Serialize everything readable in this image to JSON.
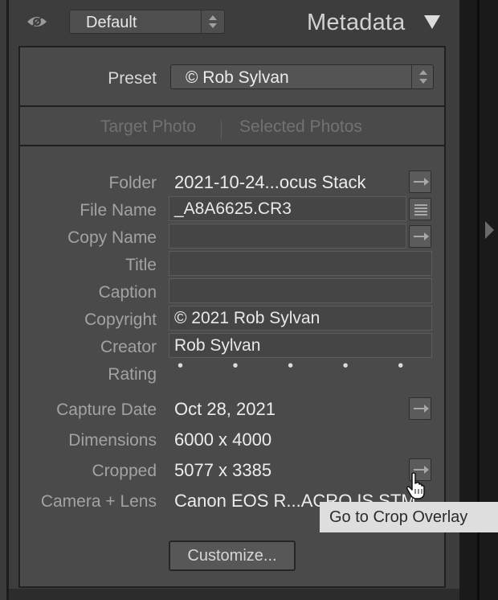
{
  "header": {
    "preset_value": "Default",
    "panel_title": "Metadata"
  },
  "preset_row": {
    "label": "Preset",
    "value": "© Rob Sylvan"
  },
  "target": {
    "tab_target_photo": "Target Photo",
    "tab_selected_photos": "Selected Photos"
  },
  "fields": {
    "folder": {
      "label": "Folder",
      "value": "2021-10-24...ocus Stack"
    },
    "file_name": {
      "label": "File Name",
      "value": "_A8A6625.CR3"
    },
    "copy_name": {
      "label": "Copy Name",
      "value": ""
    },
    "title": {
      "label": "Title",
      "value": ""
    },
    "caption": {
      "label": "Caption",
      "value": ""
    },
    "copyright": {
      "label": "Copyright",
      "value": "© 2021 Rob Sylvan"
    },
    "creator": {
      "label": "Creator",
      "value": "Rob Sylvan"
    },
    "rating": {
      "label": "Rating",
      "value": "• • • • •",
      "stars": 0
    },
    "capture_date": {
      "label": "Capture Date",
      "value": "Oct 28, 2021"
    },
    "dimensions": {
      "label": "Dimensions",
      "value": "6000 x 4000"
    },
    "cropped": {
      "label": "Cropped",
      "value": "5077 x 3385"
    },
    "camera_lens": {
      "label": "Camera + Lens",
      "value": "Canon EOS R...ACRO IS STM"
    }
  },
  "customize_label": "Customize...",
  "tooltip": "Go to Crop Overlay",
  "icons": {
    "eye": "eye-icon",
    "panel_toggle": "triangle-down-icon",
    "goto": "arrow-right-icon",
    "list": "list-icon",
    "cursor": "hand-pointer-icon",
    "collapse": "triangle-right-icon"
  }
}
